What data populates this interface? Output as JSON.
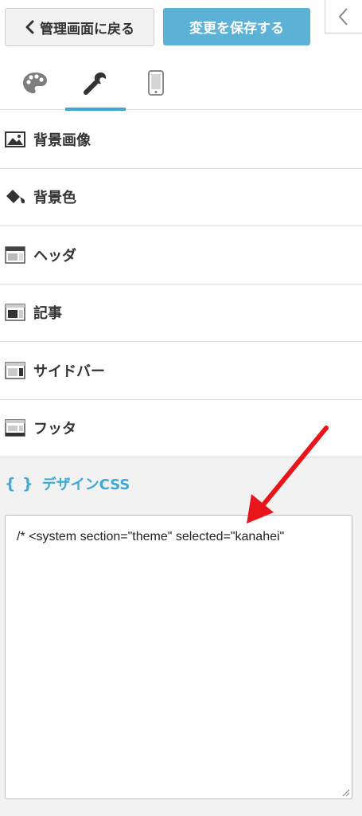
{
  "toolbar": {
    "back_label": "管理画面に戻る",
    "save_label": "変更を保存する"
  },
  "tabs": [
    {
      "icon": "palette-icon"
    },
    {
      "icon": "wrench-icon"
    },
    {
      "icon": "smartphone-icon"
    }
  ],
  "menu": {
    "items": [
      {
        "label": "背景画像",
        "icon": "image-icon"
      },
      {
        "label": "背景色",
        "icon": "paint-bucket-icon"
      },
      {
        "label": "ヘッダ",
        "icon": "layout-header-icon"
      },
      {
        "label": "記事",
        "icon": "layout-article-icon"
      },
      {
        "label": "サイドバー",
        "icon": "layout-sidebar-icon"
      },
      {
        "label": "フッタ",
        "icon": "layout-footer-icon"
      }
    ]
  },
  "design_css": {
    "icon_text": "{ }",
    "title": "デザインCSS",
    "code": "/* <system section=\"theme\" selected=\"kanahei\""
  },
  "colors": {
    "accent": "#3ea8d6",
    "save_button": "#5bb1d6",
    "annotation_arrow": "#e8161b"
  }
}
